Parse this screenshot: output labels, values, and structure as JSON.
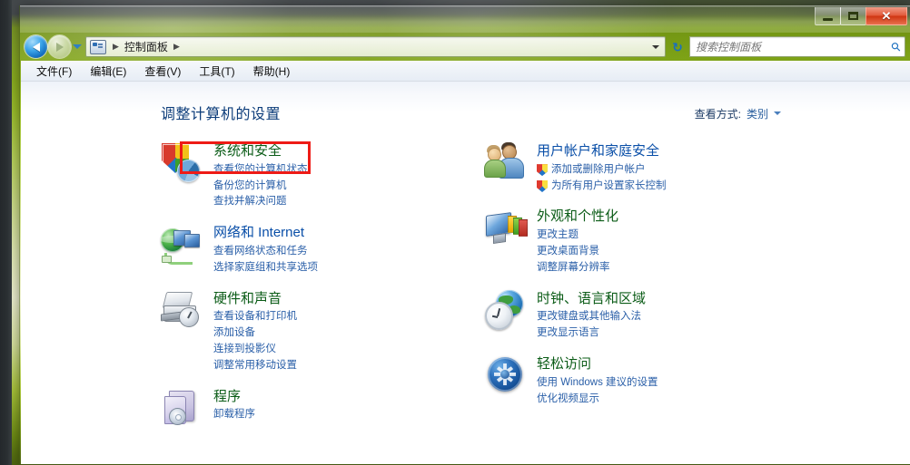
{
  "window": {
    "controls": {
      "minimize": "minimize-button",
      "maximize": "maximize-button",
      "close": "✕"
    }
  },
  "navbar": {
    "back_tooltip": "后退",
    "forward_tooltip": "前进",
    "breadcrumb": [
      {
        "label": "控制面板"
      }
    ],
    "breadcrumb_sep": "▶",
    "refresh_glyph": "↻",
    "search": {
      "placeholder": "搜索控制面板",
      "value": "",
      "icon": "🔍"
    }
  },
  "menubar": {
    "items": [
      {
        "label": "文件(F)"
      },
      {
        "label": "编辑(E)"
      },
      {
        "label": "查看(V)"
      },
      {
        "label": "工具(T)"
      },
      {
        "label": "帮助(H)"
      }
    ]
  },
  "content": {
    "page_title": "调整计算机的设置",
    "view_by": {
      "label": "查看方式:",
      "value": "类别"
    },
    "left_column": [
      {
        "title": "系统和安全",
        "icon": "security-shield-icon",
        "highlighted": true,
        "links": [
          {
            "text": "查看您的计算机状态",
            "shield": false
          },
          {
            "text": "备份您的计算机",
            "shield": false
          },
          {
            "text": "查找并解决问题",
            "shield": false
          }
        ]
      },
      {
        "title": "网络和 Internet",
        "icon": "network-globe-icon",
        "highlighted": false,
        "links": [
          {
            "text": "查看网络状态和任务",
            "shield": false
          },
          {
            "text": "选择家庭组和共享选项",
            "shield": false
          }
        ]
      },
      {
        "title": "硬件和声音",
        "icon": "printer-device-icon",
        "highlighted": false,
        "links": [
          {
            "text": "查看设备和打印机",
            "shield": false
          },
          {
            "text": "添加设备",
            "shield": false
          },
          {
            "text": "连接到投影仪",
            "shield": false
          },
          {
            "text": "调整常用移动设置",
            "shield": false
          }
        ]
      },
      {
        "title": "程序",
        "icon": "programs-box-icon",
        "highlighted": false,
        "links": [
          {
            "text": "卸载程序",
            "shield": false
          }
        ]
      }
    ],
    "right_column": [
      {
        "title": "用户帐户和家庭安全",
        "icon": "user-accounts-icon",
        "highlighted": false,
        "links": [
          {
            "text": "添加或删除用户帐户",
            "shield": true
          },
          {
            "text": "为所有用户设置家长控制",
            "shield": true
          }
        ]
      },
      {
        "title": "外观和个性化",
        "icon": "appearance-display-icon",
        "highlighted": false,
        "links": [
          {
            "text": "更改主题",
            "shield": false
          },
          {
            "text": "更改桌面背景",
            "shield": false
          },
          {
            "text": "调整屏幕分辨率",
            "shield": false
          }
        ]
      },
      {
        "title": "时钟、语言和区域",
        "icon": "clock-language-region-icon",
        "highlighted": false,
        "links": [
          {
            "text": "更改键盘或其他输入法",
            "shield": false
          },
          {
            "text": "更改显示语言",
            "shield": false
          }
        ]
      },
      {
        "title": "轻松访问",
        "icon": "ease-of-access-icon",
        "highlighted": false,
        "links": [
          {
            "text": "使用 Windows 建议的设置",
            "shield": false
          },
          {
            "text": "优化视频显示",
            "shield": false
          }
        ]
      }
    ]
  },
  "colors": {
    "category_title": "#0b5c17",
    "category_title_blue": "#0a4fa8",
    "link": "#2a5fa8",
    "page_title": "#0c3c7a",
    "annotation": "#ee1b16",
    "close_button": "#cf3512"
  }
}
